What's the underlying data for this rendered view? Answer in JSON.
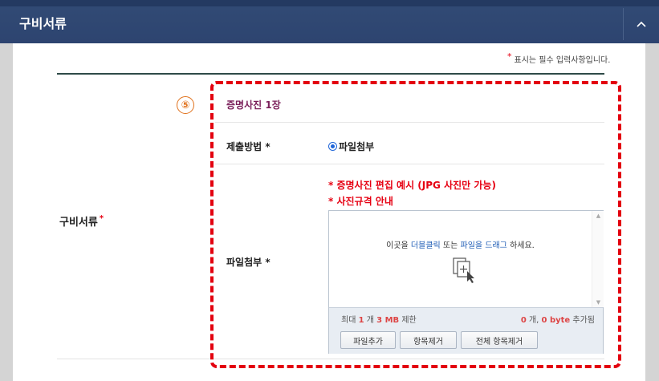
{
  "header": {
    "title": "구비서류",
    "collapse_icon": "chevron-up-icon"
  },
  "required_note": {
    "star": "*",
    "text": "표시는 필수 입력사항입니다."
  },
  "row": {
    "label": "구비서류",
    "required_star": "*"
  },
  "annotation": {
    "number": "⑤",
    "highlight_color": "#e3000f"
  },
  "section": {
    "title": "증명사진 1장",
    "title_color": "#7a1f5a"
  },
  "submit_method": {
    "label": "제출방법 *",
    "option": "파일첨부",
    "selected": true
  },
  "attachment": {
    "label": "파일첨부 *",
    "links": [
      "* 증명사진 편집 예시 (JPG 사진만 가능)",
      "* 사진규격 안내"
    ],
    "drop": {
      "prefix": "이곳을 ",
      "dblclick": "더블클릭",
      "middle": " 또는 ",
      "drag": "파일을 드래그",
      "suffix": " 하세요.",
      "icon": "file-add-icon"
    },
    "limit": {
      "prefix": "최대 ",
      "count": "1",
      "unit1": " 개 ",
      "size": "3 MB",
      "suffix": " 제한"
    },
    "status": {
      "count": "0",
      "unit1": " 개, ",
      "bytes": "0 byte",
      "suffix": " 추가됨"
    },
    "buttons": {
      "add": "파일추가",
      "remove": "항목제거",
      "remove_all": "전체 항목제거"
    }
  }
}
